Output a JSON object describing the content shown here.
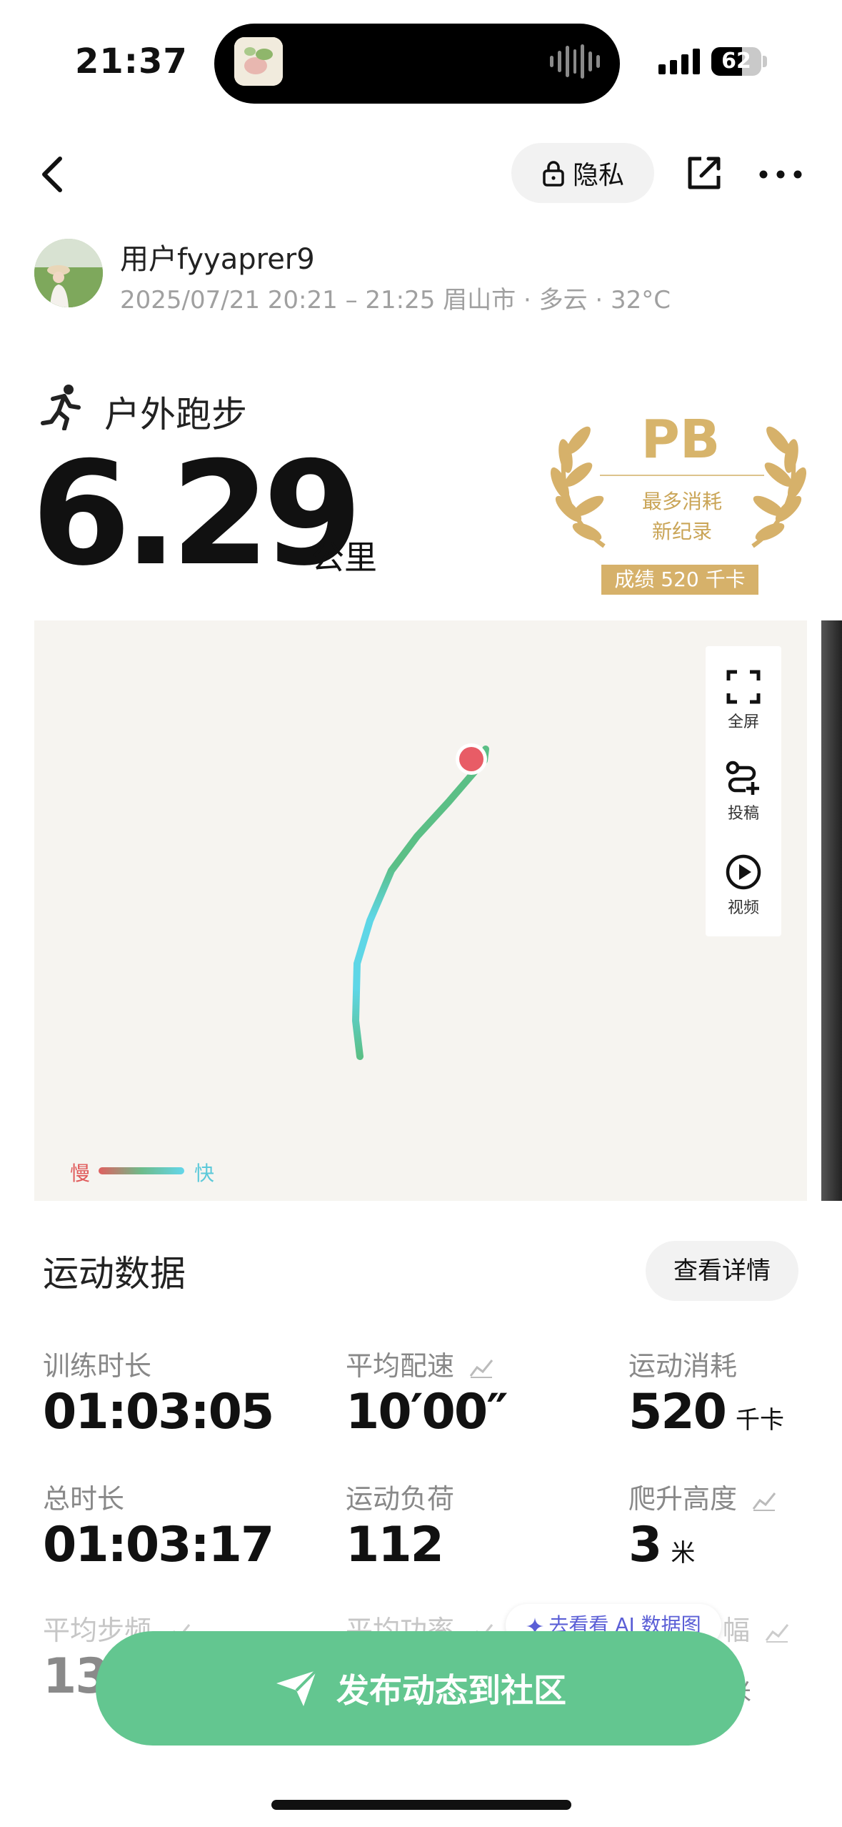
{
  "status_bar": {
    "time": "21:37",
    "battery": "62",
    "battery_level": 0.62
  },
  "nav": {
    "privacy_label": "隐私"
  },
  "user": {
    "name": "用户fyyaprer9",
    "meta": "2025/07/21 20:21 – 21:25 眉山市 · 多云 · 32°C"
  },
  "activity": {
    "type": "户外跑步",
    "distance": "6.29",
    "unit": "公里"
  },
  "badge": {
    "title": "PB",
    "line1": "最多消耗",
    "line2": "新纪录",
    "score": "成绩 520 千卡"
  },
  "map": {
    "tools": {
      "fullscreen": "全屏",
      "submit": "投稿",
      "video": "视频"
    },
    "legend": {
      "slow": "慢",
      "fast": "快"
    }
  },
  "stats": {
    "title": "运动数据",
    "detail_button": "查看详情",
    "items": [
      {
        "label": "训练时长",
        "value": "01:03:05",
        "unit": ""
      },
      {
        "label": "平均配速",
        "value": "10′00″",
        "unit": ""
      },
      {
        "label": "运动消耗",
        "value": "520",
        "unit": "千卡"
      },
      {
        "label": "总时长",
        "value": "01:03:17",
        "unit": ""
      },
      {
        "label": "运动负荷",
        "value": "112",
        "unit": ""
      },
      {
        "label": "爬升高度",
        "value": "3",
        "unit": "米"
      },
      {
        "label": "平均步频",
        "value": "13",
        "unit": ""
      },
      {
        "label": "平均功率",
        "value": "",
        "unit": ""
      },
      {
        "label": "幅",
        "value": "",
        "unit": "米"
      }
    ]
  },
  "ai_pill": "去看看 AI 数据图",
  "publish_button": "发布动态到社区",
  "colors": {
    "accent_green": "#63c690",
    "gold": "#d6b16a",
    "route_green": "#5bbf86",
    "route_cyan": "#5ed6e6",
    "end_marker": "#e85c66"
  }
}
